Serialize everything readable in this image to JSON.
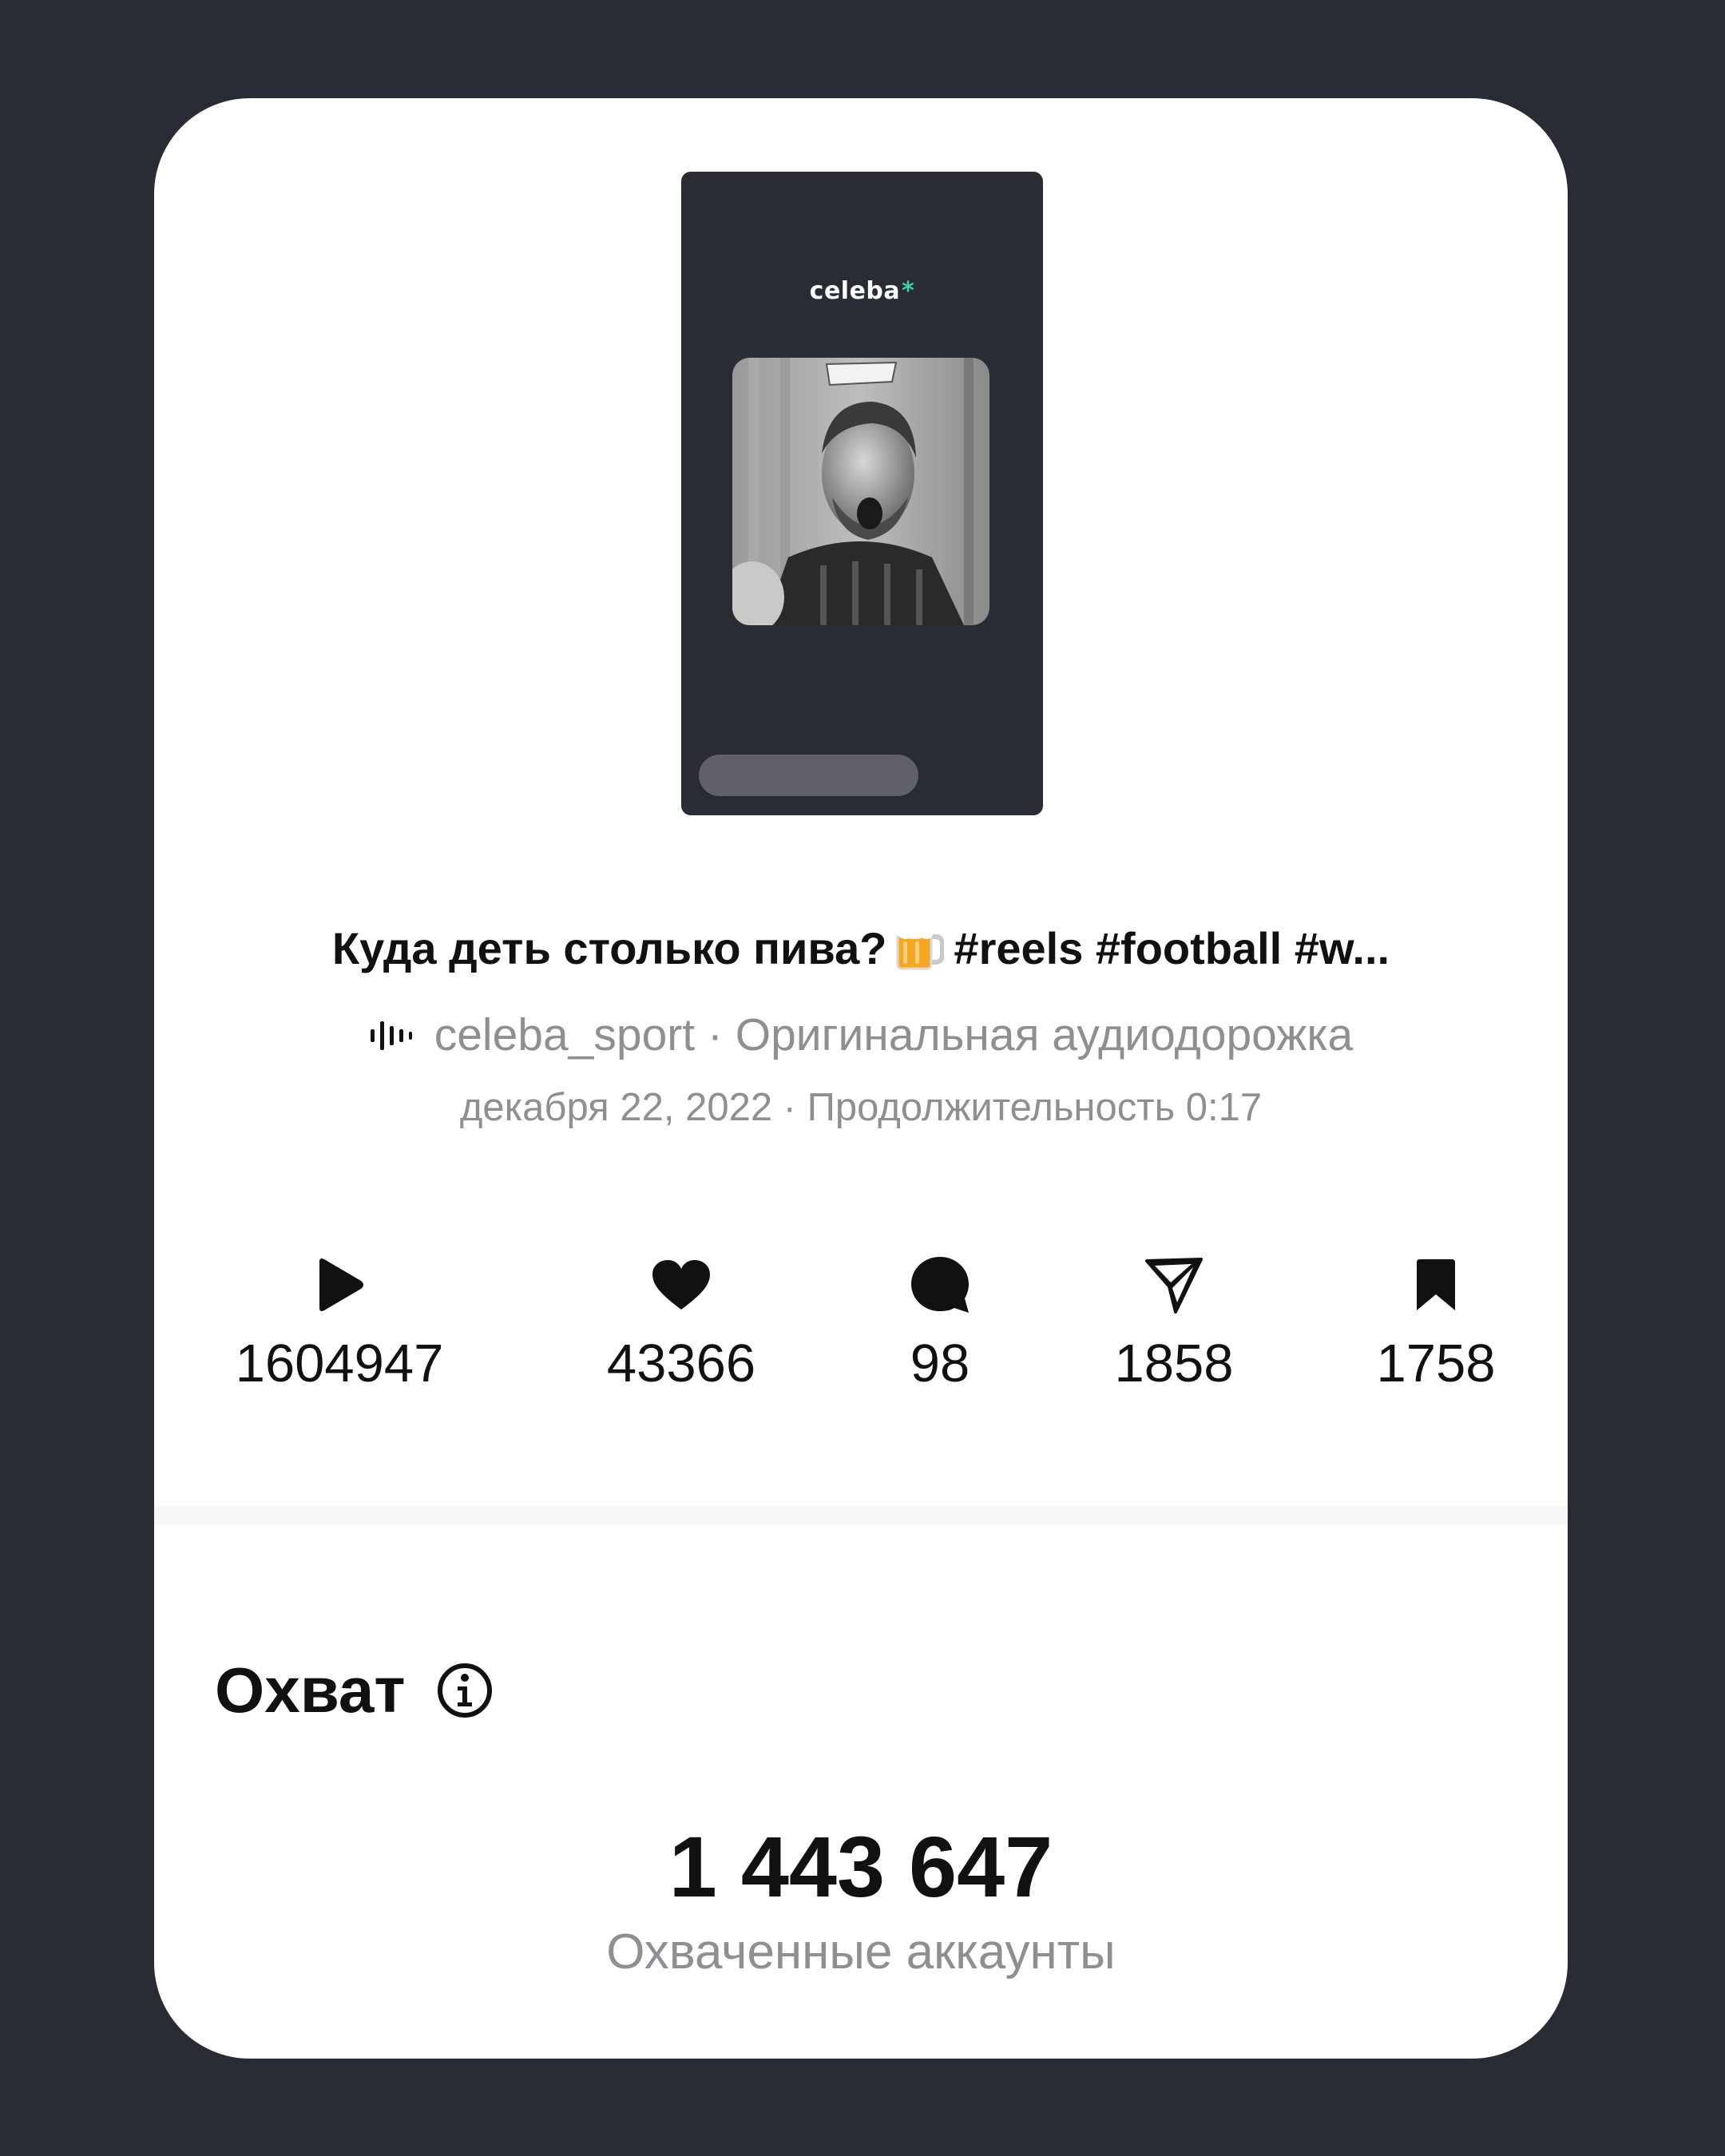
{
  "post": {
    "thumbnail": {
      "brand_logo": "celeba",
      "brand_logo_star": "*",
      "photo_description": "grayscale football player photo"
    },
    "caption": {
      "text_before_emoji": "Куда деть столько пива?",
      "emoji": "beer-mug-icon",
      "hashtags": "#reels #football #w..."
    },
    "audio": {
      "icon": "audio-wave-icon",
      "text": "celeba_sport · Оригинальная аудиодорожка"
    },
    "meta": {
      "text": "декабря 22, 2022 · Продолжительность 0:17"
    }
  },
  "stats": [
    {
      "name": "plays",
      "icon": "play-icon",
      "value": "1604947"
    },
    {
      "name": "likes",
      "icon": "heart-icon",
      "value": "43366"
    },
    {
      "name": "comments",
      "icon": "comment-icon",
      "value": "98"
    },
    {
      "name": "shares",
      "icon": "send-icon",
      "value": "1858"
    },
    {
      "name": "saves",
      "icon": "bookmark-icon",
      "value": "1758"
    }
  ],
  "reach": {
    "title": "Охват",
    "info_icon": "info-icon",
    "value": "1 443 647",
    "label": "Охваченные аккаунты"
  },
  "colors": {
    "background": "#292c35",
    "card": "#ffffff",
    "text_primary": "#111111",
    "text_secondary": "#8e8e93",
    "thumbnail_bg": "#292c35",
    "logo_star": "#3ed6a8"
  }
}
